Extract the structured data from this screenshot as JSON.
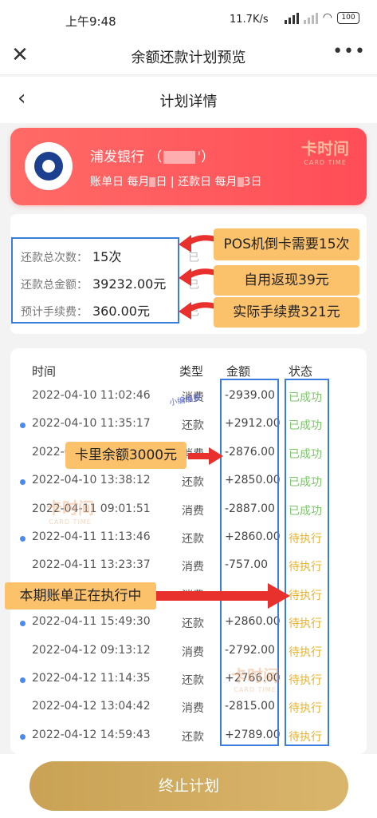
{
  "status_bar": {
    "time": "上午9:48",
    "network_speed": "11.7K/s",
    "battery": "100"
  },
  "navbar": {
    "title": "余额还款计划预览",
    "close_glyph": "✕",
    "more_glyph": "•••"
  },
  "subnav": {
    "title": "计划详情",
    "back_glyph": "‹"
  },
  "card": {
    "bank_name": "浦发银行",
    "paren_open": "（",
    "paren_close": "'）",
    "bill_day": "账单日 每月",
    "bill_day_suffix": "日",
    "separator": "|",
    "repay_day": "还款日 每月",
    "repay_day_suffix": "3日",
    "watermark": "卡时间",
    "watermark_en": "CARD TIME"
  },
  "summary": {
    "total_count_label": "还款总次数：",
    "total_count_value": "15次",
    "total_amount_label": "还款总金额：",
    "total_amount_value": "39232.00元",
    "fee_label": "预计手续费：",
    "fee_value": "360.00元",
    "frag1": "已",
    "frag2": "已",
    "frag3": "已"
  },
  "annotations": {
    "pos": "POS机倒卡需要15次",
    "cashback": "自用返现39元",
    "actual_fee": "实际手续费321元",
    "balance": "卡里余额3000元",
    "executing": "本期账单正在执行中",
    "tiny_tag": "小编编费"
  },
  "table": {
    "headers": {
      "time": "时间",
      "type": "类型",
      "amount": "金额",
      "status": "状态"
    },
    "rows": [
      {
        "time": "2022-04-10 11:02:46",
        "type": "消费",
        "amount": "-2939.00",
        "status": "已成功",
        "dot": false
      },
      {
        "time": "2022-04-10 11:35:17",
        "type": "还款",
        "amount": "+2912.00",
        "status": "已成功",
        "dot": true
      },
      {
        "time": "2022-04-10 12:0",
        "type": "消费",
        "amount": "-2876.00",
        "status": "已成功",
        "dot": false
      },
      {
        "time": "2022-04-10 13:38:12",
        "type": "还款",
        "amount": "+2850.00",
        "status": "已成功",
        "dot": true
      },
      {
        "time": "2022-04-11 09:01:51",
        "type": "消费",
        "amount": "-2887.00",
        "status": "已成功",
        "dot": false
      },
      {
        "time": "2022-04-11 11:13:46",
        "type": "还款",
        "amount": "+2860.00",
        "status": "待执行",
        "dot": true
      },
      {
        "time": "2022-04-11 13:23:37",
        "type": "消费",
        "amount": "-757.00",
        "status": "待执行",
        "dot": false
      },
      {
        "time": "",
        "type": "消费",
        "amount": "",
        "status": "待执行",
        "dot": false
      },
      {
        "time": "2022-04-11 15:49:30",
        "type": "还款",
        "amount": "+2860.00",
        "status": "待执行",
        "dot": true
      },
      {
        "time": "2022-04-12 09:13:12",
        "type": "消费",
        "amount": "-2792.00",
        "status": "待执行",
        "dot": false
      },
      {
        "time": "2022-04-12 11:14:35",
        "type": "还款",
        "amount": "+2766.00",
        "status": "待执行",
        "dot": true
      },
      {
        "time": "2022-04-12 13:04:42",
        "type": "消费",
        "amount": "-2815.00",
        "status": "待执行",
        "dot": false
      },
      {
        "time": "2022-04-12 14:59:43",
        "type": "还款",
        "amount": "+2789.00",
        "status": "待执行",
        "dot": true
      }
    ]
  },
  "watermark": {
    "text": "卡时间",
    "en": "CARD TIME"
  },
  "bottom": {
    "stop_button": "终止计划"
  },
  "colors": {
    "card_red": "#ff5158",
    "gold_button": "#d1ac62",
    "callout": "#fcc26b",
    "frame_blue": "#3a7de0",
    "arrow_red": "#e8302c",
    "success_green": "#7cc66a",
    "pending_yellow": "#e8b32a"
  }
}
